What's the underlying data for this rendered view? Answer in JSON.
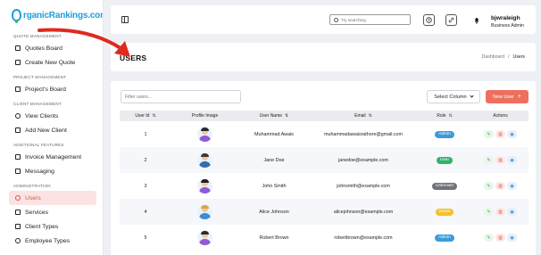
{
  "app": {
    "logo_text": "rganicRankings.com",
    "logo_initial": "O"
  },
  "sidebar": {
    "sections": [
      {
        "title": "QUOTE MANAGEMENT",
        "items": [
          {
            "label": "Quotes Board",
            "icon": "board-icon"
          },
          {
            "label": "Create New Quote",
            "icon": "quote-add-icon"
          }
        ]
      },
      {
        "title": "PROJECT MANAGEMENT",
        "items": [
          {
            "label": "Project's Board",
            "icon": "board-icon"
          }
        ]
      },
      {
        "title": "CLIENT MANAGEMENT",
        "items": [
          {
            "label": "View Clients",
            "icon": "clients-icon"
          },
          {
            "label": "Add New Client",
            "icon": "add-client-icon"
          }
        ]
      },
      {
        "title": "ADDITIONAL FEATURES",
        "items": [
          {
            "label": "Invoice Management",
            "icon": "invoice-icon"
          },
          {
            "label": "Messaging",
            "icon": "message-icon"
          }
        ]
      },
      {
        "title": "ADMINISTRATION",
        "items": [
          {
            "label": "Users",
            "icon": "users-icon",
            "active": true
          },
          {
            "label": "Services",
            "icon": "services-icon"
          },
          {
            "label": "Client Types",
            "icon": "client-types-icon"
          },
          {
            "label": "Employee Types",
            "icon": "employee-types-icon"
          }
        ]
      }
    ]
  },
  "header": {
    "search_placeholder": "Try searching",
    "user_name": "bjwraleigh",
    "user_role": "Business Admin"
  },
  "page": {
    "title": "USERS",
    "breadcrumb": [
      "Dashboard",
      "/",
      "Users"
    ]
  },
  "toolbar": {
    "filter_placeholder": "Filter users...",
    "select_column_label": "Select Column",
    "new_user_label": "New User",
    "new_user_plus": "+"
  },
  "table": {
    "columns": [
      "User Id",
      "Profile Image",
      "User Name",
      "Email",
      "Role",
      "Actions"
    ],
    "rows": [
      {
        "id": "1",
        "name": "Muhammad Awais",
        "email": "muhammadawaisrathore@gmail.com",
        "role": "Admin",
        "role_color": "#3b9bd9",
        "avatar": {
          "hair": "#2b2b2b",
          "body": "#8e5bd6"
        }
      },
      {
        "id": "2",
        "name": "Jane Doe",
        "email": "janedoe@example.com",
        "role": "User",
        "role_color": "#2fb36b",
        "avatar": {
          "hair": "#3a3a3a",
          "body": "#2f6fb0"
        }
      },
      {
        "id": "3",
        "name": "John Smith",
        "email": "johnsmith@example.com",
        "role": "Unknown",
        "role_color": "#6f747a",
        "avatar": {
          "hair": "#1e1e1e",
          "body": "#8e5bd6"
        }
      },
      {
        "id": "4",
        "name": "Alice Johnson",
        "email": "alicejohnson@example.com",
        "role": "Guest",
        "role_color": "#f2c12e",
        "avatar": {
          "hair": "#d8a54a",
          "body": "#3a8fd1"
        }
      },
      {
        "id": "5",
        "name": "Robert Brown",
        "email": "robertbrown@example.com",
        "role": "Admin",
        "role_color": "#3b9bd9",
        "avatar": {
          "hair": "#2b2b2b",
          "body": "#8e5bd6"
        }
      }
    ]
  },
  "colors": {
    "accent": "#ef6f5f",
    "active_nav_bg": "#fbe3e3",
    "annotation_arrow": "#e02a1f"
  }
}
